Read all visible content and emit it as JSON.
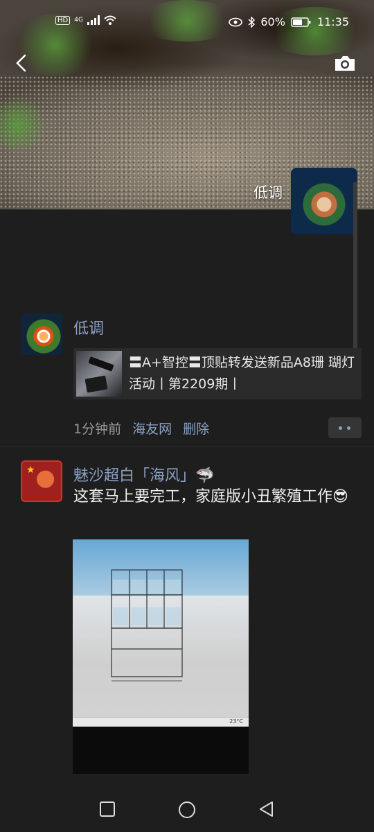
{
  "status_bar": {
    "hd_label": "HD",
    "net_label": "4G",
    "battery_percent": "60%",
    "time": "11:35"
  },
  "cover": {
    "user_name": "低调"
  },
  "post1": {
    "user_name": "低调",
    "share_title": "〓A+智控〓顶贴转发送新品A8珊 瑚灯活动丨第2209期丨",
    "time_ago": "1分钟前",
    "source": "海友网",
    "delete_label": "删除"
  },
  "post2": {
    "user_name": "魅沙超白「海风」🦈",
    "text": "这套马上要完工，家庭版小丑繁殖工作😎",
    "photo_caption": "23°C"
  },
  "colors": {
    "link": "#8aa1c6",
    "background": "#1e1e1e"
  }
}
